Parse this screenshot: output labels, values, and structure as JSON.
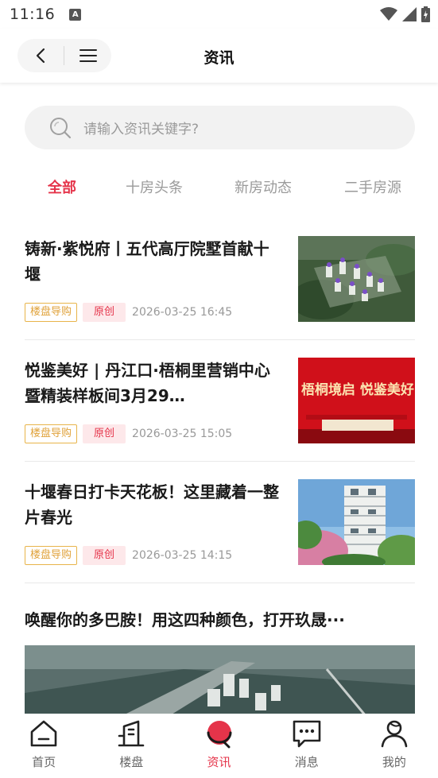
{
  "status": {
    "time": "11:16",
    "notification_badge": "A"
  },
  "header": {
    "title": "资讯"
  },
  "search": {
    "placeholder": "请输入资讯关键字?"
  },
  "tabs": [
    {
      "label": "全部",
      "active": true
    },
    {
      "label": "十房头条",
      "active": false
    },
    {
      "label": "新房动态",
      "active": false
    },
    {
      "label": "二手房源",
      "active": false
    }
  ],
  "articles": [
    {
      "title": "铸新·紫悦府丨五代高厅院墅首献十堰",
      "tag_guide": "楼盘导购",
      "tag_orig": "原创",
      "date": "2026-03-25 16:45"
    },
    {
      "title": "悦鉴美好 | 丹江口·梧桐里营销中心暨精装样板间3月29…",
      "tag_guide": "楼盘导购",
      "tag_orig": "原创",
      "date": "2026-03-25 15:05",
      "thumb_text": "梧桐境启 悦鉴美好"
    },
    {
      "title": "十堰春日打卡天花板！这里藏着一整片春光",
      "tag_guide": "楼盘导购",
      "tag_orig": "原创",
      "date": "2026-03-25 14:15"
    },
    {
      "title": "唤醒你的多巴胺！用这四种颜色，打开玖晟···"
    }
  ],
  "tabbar": [
    {
      "label": "首页",
      "icon": "home-icon",
      "active": false
    },
    {
      "label": "楼盘",
      "icon": "building-icon",
      "active": false
    },
    {
      "label": "资讯",
      "icon": "news-icon",
      "active": true
    },
    {
      "label": "消息",
      "icon": "message-icon",
      "active": false
    },
    {
      "label": "我的",
      "icon": "profile-icon",
      "active": false
    }
  ],
  "colors": {
    "accent": "#e5344a",
    "tag_guide": "#e0a23a",
    "tag_orig_bg": "#fde8ea"
  }
}
